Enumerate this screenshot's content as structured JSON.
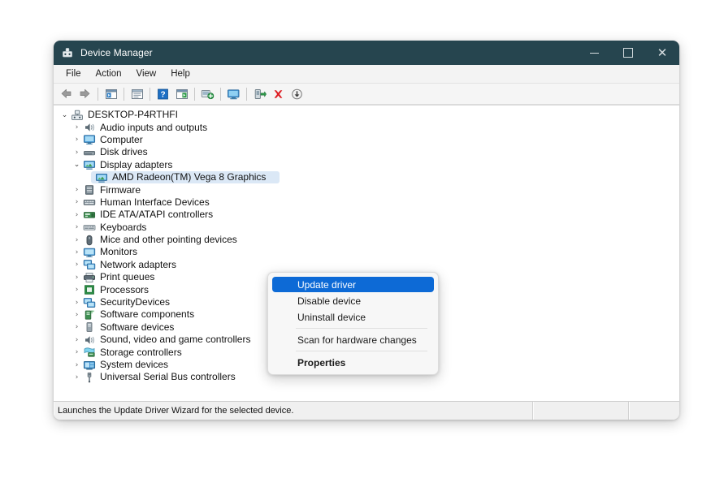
{
  "window": {
    "title": "Device Manager",
    "icon": "device-manager-icon",
    "controls": {
      "minimize": "minimize-icon",
      "maximize": "maximize-icon",
      "close": "close-icon"
    }
  },
  "menubar": {
    "items": [
      {
        "label": "File",
        "name": "menu-file"
      },
      {
        "label": "Action",
        "name": "menu-action"
      },
      {
        "label": "View",
        "name": "menu-view"
      },
      {
        "label": "Help",
        "name": "menu-help"
      }
    ]
  },
  "toolbar": {
    "buttons": [
      {
        "name": "back-icon"
      },
      {
        "name": "forward-icon"
      },
      {
        "name": "separator"
      },
      {
        "name": "show-hide-console-tree-icon"
      },
      {
        "name": "separator"
      },
      {
        "name": "properties-icon"
      },
      {
        "name": "separator"
      },
      {
        "name": "help-icon"
      },
      {
        "name": "show-hidden-devices-icon"
      },
      {
        "name": "separator"
      },
      {
        "name": "scan-for-hardware-changes-icon"
      },
      {
        "name": "separator"
      },
      {
        "name": "device-display-icon"
      },
      {
        "name": "separator"
      },
      {
        "name": "enable-device-icon"
      },
      {
        "name": "uninstall-device-icon"
      },
      {
        "name": "update-driver-icon"
      }
    ]
  },
  "tree": {
    "root": {
      "label": "DESKTOP-P4RTHFI",
      "icon": "computer-root-icon",
      "expanded": true
    },
    "items": [
      {
        "label": "Audio inputs and outputs",
        "icon": "speaker-icon",
        "expanded": false,
        "level": 1
      },
      {
        "label": "Computer",
        "icon": "computer-icon",
        "expanded": false,
        "level": 1
      },
      {
        "label": "Disk drives",
        "icon": "disk-drive-icon",
        "expanded": false,
        "level": 1
      },
      {
        "label": "Display adapters",
        "icon": "display-adapter-icon",
        "expanded": true,
        "level": 1
      },
      {
        "label": "AMD Radeon(TM) Vega 8 Graphics",
        "icon": "display-adapter-icon",
        "expanded": null,
        "level": 2,
        "selected": true
      },
      {
        "label": "Firmware",
        "icon": "firmware-icon",
        "expanded": false,
        "level": 1
      },
      {
        "label": "Human Interface Devices",
        "icon": "hid-icon",
        "expanded": false,
        "level": 1
      },
      {
        "label": "IDE ATA/ATAPI controllers",
        "icon": "ide-controller-icon",
        "expanded": false,
        "level": 1
      },
      {
        "label": "Keyboards",
        "icon": "keyboard-icon",
        "expanded": false,
        "level": 1
      },
      {
        "label": "Mice and other pointing devices",
        "icon": "mouse-icon",
        "expanded": false,
        "level": 1
      },
      {
        "label": "Monitors",
        "icon": "monitor-icon",
        "expanded": false,
        "level": 1
      },
      {
        "label": "Network adapters",
        "icon": "network-adapter-icon",
        "expanded": false,
        "level": 1
      },
      {
        "label": "Print queues",
        "icon": "printer-icon",
        "expanded": false,
        "level": 1
      },
      {
        "label": "Processors",
        "icon": "processor-icon",
        "expanded": false,
        "level": 1
      },
      {
        "label": "SecurityDevices",
        "icon": "security-device-icon",
        "expanded": false,
        "level": 1
      },
      {
        "label": "Software components",
        "icon": "software-component-icon",
        "expanded": false,
        "level": 1
      },
      {
        "label": "Software devices",
        "icon": "software-device-icon",
        "expanded": false,
        "level": 1
      },
      {
        "label": "Sound, video and game controllers",
        "icon": "speaker-icon",
        "expanded": false,
        "level": 1
      },
      {
        "label": "Storage controllers",
        "icon": "storage-controller-icon",
        "expanded": false,
        "level": 1
      },
      {
        "label": "System devices",
        "icon": "system-device-icon",
        "expanded": false,
        "level": 1
      },
      {
        "label": "Universal Serial Bus controllers",
        "icon": "usb-icon",
        "expanded": false,
        "level": 1
      }
    ]
  },
  "context_menu": {
    "items": [
      {
        "label": "Update driver",
        "selected": true,
        "bold": false
      },
      {
        "label": "Disable device",
        "selected": false,
        "bold": false
      },
      {
        "label": "Uninstall device",
        "selected": false,
        "bold": false
      },
      {
        "separator": true
      },
      {
        "label": "Scan for hardware changes",
        "selected": false,
        "bold": false
      },
      {
        "separator": true
      },
      {
        "label": "Properties",
        "selected": false,
        "bold": true
      }
    ]
  },
  "statusbar": {
    "message": "Launches the Update Driver Wizard for the selected device.",
    "pane2": "",
    "pane3": ""
  },
  "colors": {
    "titlebar": "#26454f",
    "menu_highlight": "#0d6ad6",
    "tree_selection": "#dbe8f6"
  }
}
